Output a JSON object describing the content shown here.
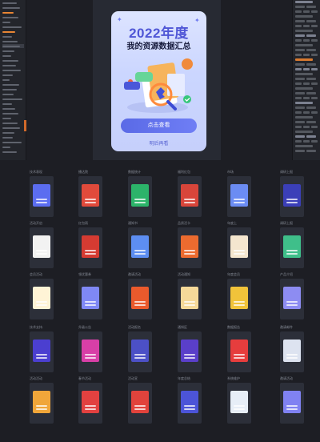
{
  "poster": {
    "year": "2022年度",
    "subtitle": "我的资源数据汇总",
    "button": "点击查看",
    "link": "明后再看"
  },
  "thumbnails": [
    {
      "label": "技术表现",
      "color": "#5b6df0"
    },
    {
      "label": "播达院",
      "color": "#e04a3b"
    },
    {
      "label": "数据统计",
      "color": "#2cb46a"
    },
    {
      "label": "福利红包",
      "color": "#d8453a"
    },
    {
      "label": "市场",
      "color": "#6b8cf3"
    },
    {
      "label": "调研上报",
      "color": "#3b3fb8"
    },
    {
      "label": "活动开启",
      "color": "#f2f2f2"
    },
    {
      "label": "红包雨",
      "color": "#d53b32"
    },
    {
      "label": "通知书",
      "color": "#5d8ef2"
    },
    {
      "label": "品质活卡",
      "color": "#ec6b2f"
    },
    {
      "label": "年度上",
      "color": "#f4e6cf"
    },
    {
      "label": "调研上报",
      "color": "#3fbf8a"
    },
    {
      "label": "会员活动",
      "color": "#fff4d6"
    },
    {
      "label": "领优惠券",
      "color": "#7f88f5"
    },
    {
      "label": "邀请活动",
      "color": "#ea5a2c"
    },
    {
      "label": "活动通知",
      "color": "#f5d999"
    },
    {
      "label": "年度会员",
      "color": "#f1c33a"
    },
    {
      "label": "产品介绍",
      "color": "#8d8cf2"
    },
    {
      "label": "技术支持",
      "color": "#4b3fd0"
    },
    {
      "label": "升级公告",
      "color": "#d83fa7"
    },
    {
      "label": "活动报名",
      "color": "#4c50c6"
    },
    {
      "label": "通知区",
      "color": "#5a3fc9"
    },
    {
      "label": "数据报告",
      "color": "#e63d3d"
    },
    {
      "label": "邀请邮件",
      "color": "#dde3f0"
    },
    {
      "label": "活动活动",
      "color": "#f0a63a"
    },
    {
      "label": "春节活动",
      "color": "#e24140"
    },
    {
      "label": "活动宣",
      "color": "#e1433c"
    },
    {
      "label": "年度总结",
      "color": "#4c54d8"
    },
    {
      "label": "系统维护",
      "color": "#e7eef7"
    },
    {
      "label": "邀请活动",
      "color": "#8082f2"
    }
  ]
}
